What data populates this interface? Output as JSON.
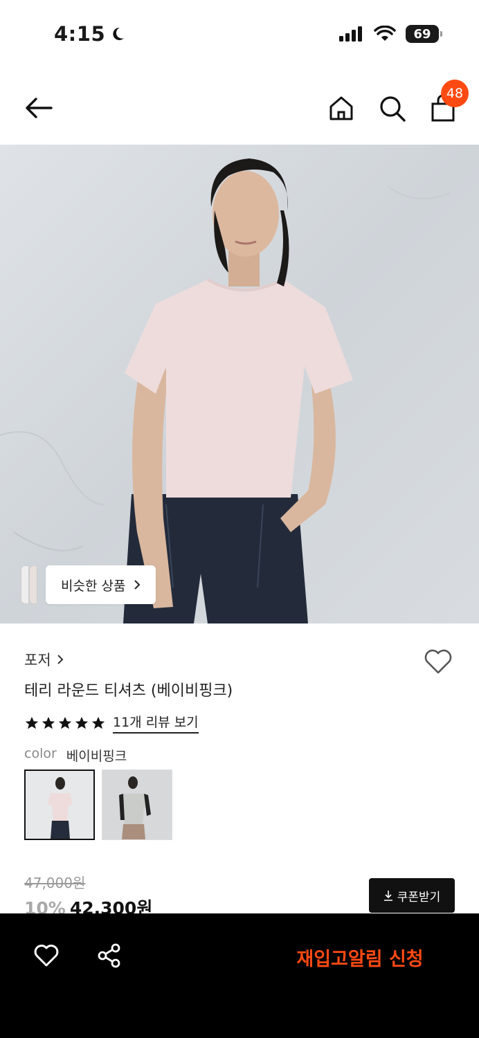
{
  "status_bar": {
    "time": "4:15",
    "battery": "69",
    "icons": [
      "moon-icon",
      "signal-icon",
      "wifi-icon",
      "battery-icon"
    ]
  },
  "header": {
    "icons": [
      "back-arrow-icon",
      "home-icon",
      "search-icon",
      "shopping-bag-icon"
    ],
    "cart_count": "48",
    "badge_color": "#ff4a12"
  },
  "hero": {
    "similar_label": "비슷한 상품"
  },
  "product": {
    "brand": "포저",
    "title": "테리 라운드 티셔츠 (베이비핑크)",
    "rating_stars": 5,
    "review_link": "11개 리뷰 보기",
    "color_label": "color",
    "color_value": "베이비핑크"
  },
  "price": {
    "original": "47,000원",
    "discount": "10%",
    "sale": "42,300원",
    "coupon_label": "쿠폰받기"
  },
  "bottom_bar": {
    "restock_label": "재입고알림 신청",
    "accent": "#ff4a12"
  }
}
